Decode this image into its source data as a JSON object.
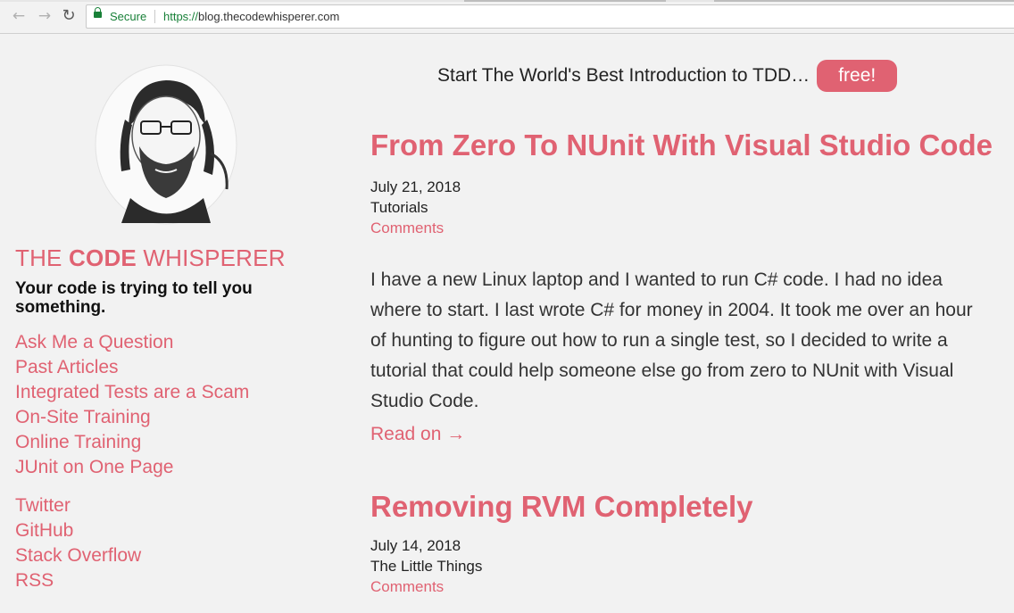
{
  "browser": {
    "secure_label": "Secure",
    "url_protocol": "https://",
    "url_host": "blog.thecodewhisperer.com",
    "back_icon": "arrow-left-icon",
    "forward_icon": "arrow-right-icon",
    "reload_icon": "reload-icon"
  },
  "colors": {
    "accent": "#e06272",
    "background": "#f2f2f2",
    "secure_green": "#188038"
  },
  "sidebar": {
    "brand_the": "THE",
    "brand_code": "CODE",
    "brand_whisperer": "WHISPERER",
    "tagline": "Your code is trying to tell you something.",
    "links": [
      {
        "label": "Ask Me a Question"
      },
      {
        "label": "Past Articles"
      },
      {
        "label": "Integrated Tests are a Scam"
      },
      {
        "label": "On-Site Training"
      },
      {
        "label": "Online Training"
      },
      {
        "label": "JUnit on One Page"
      }
    ],
    "social": [
      {
        "label": "Twitter"
      },
      {
        "label": "GitHub"
      },
      {
        "label": "Stack Overflow"
      },
      {
        "label": "RSS"
      }
    ]
  },
  "promo": {
    "text": "Start The World's Best Introduction to TDD…",
    "button": "free!"
  },
  "posts": [
    {
      "title": "From Zero To NUnit With Visual Studio Code",
      "date": "July 21, 2018",
      "category": "Tutorials",
      "comments": "Comments",
      "excerpt": "I have a new Linux laptop and I wanted to run C# code. I had no idea where to start. I last wrote C# for money in 2004. It took me over an hour of hunting to figure out how to run a single test, so I decided to write a tutorial that could help someone else go from zero to NUnit with Visual Studio Code.",
      "read_on": "Read on →"
    },
    {
      "title": "Removing RVM Completely",
      "date": "July 14, 2018",
      "category": "The Little Things",
      "comments": "Comments"
    }
  ]
}
